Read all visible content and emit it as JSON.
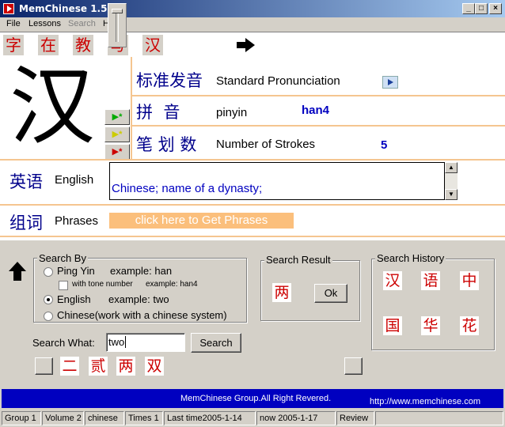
{
  "window": {
    "title": "MemChinese 1.5",
    "controls": [
      "_",
      "□",
      "×"
    ]
  },
  "menu": {
    "items": [
      "File",
      "Lessons",
      "Search",
      "Help"
    ],
    "disabled": [
      "Search"
    ]
  },
  "history_bar": {
    "chars": [
      "字",
      "在",
      "教",
      "写",
      "汉"
    ]
  },
  "character": {
    "glyph": "汉",
    "play_buttons": [
      "▶*",
      "▶*",
      "▶*"
    ],
    "standard_pronunciation": {
      "cn": "标准发音",
      "en": "Standard Pronunciation"
    },
    "pinyin": {
      "cn": "拼  音",
      "en": "pinyin",
      "value": "han4"
    },
    "strokes": {
      "cn": "笔 划 数",
      "en": "Number of Strokes",
      "value": "5"
    },
    "english": {
      "cn": "英语",
      "en": "English",
      "value": "Chinese; name of a dynasty;"
    },
    "phrases": {
      "cn": "组词",
      "en": "Phrases",
      "button": "click here to Get Phrases"
    }
  },
  "search_by": {
    "title": "Search By",
    "options": [
      {
        "label": "Ping Yin",
        "example": "example: han",
        "checked": false
      },
      {
        "label": "English",
        "example": "example: two",
        "checked": true
      },
      {
        "label": "Chinese(work with  a chinese system)",
        "example": "",
        "checked": false
      }
    ],
    "tone_checkbox": {
      "label": "with tone number",
      "example": "example: han4",
      "checked": false
    }
  },
  "search_result": {
    "title": "Search Result",
    "char": "两",
    "ok_label": "Ok"
  },
  "search_history": {
    "title": "Search History",
    "chars": [
      "汉",
      "语",
      "中",
      "国",
      "华",
      "花"
    ]
  },
  "search_what": {
    "label": "Search What:",
    "value": "two",
    "button": "Search"
  },
  "results_row": {
    "chars": [
      "二",
      "贰",
      "两",
      "双"
    ]
  },
  "footer": {
    "copyright": "MemChinese Group.All Right Revered.",
    "url": "http://www.memchinese.com"
  },
  "status": {
    "group": "Group 1",
    "volume": "Volume 2",
    "language": "chinese",
    "times": "Times 1",
    "last_time": "Last time2005-1-14",
    "now": "now 2005-1-17",
    "review": "Review"
  },
  "colors": {
    "accent_red": "#cc0000",
    "label_blue": "#00008b",
    "value_blue": "#0000c0",
    "separator_orange": "#f5c590",
    "phrase_button": "#fbbf7c"
  }
}
